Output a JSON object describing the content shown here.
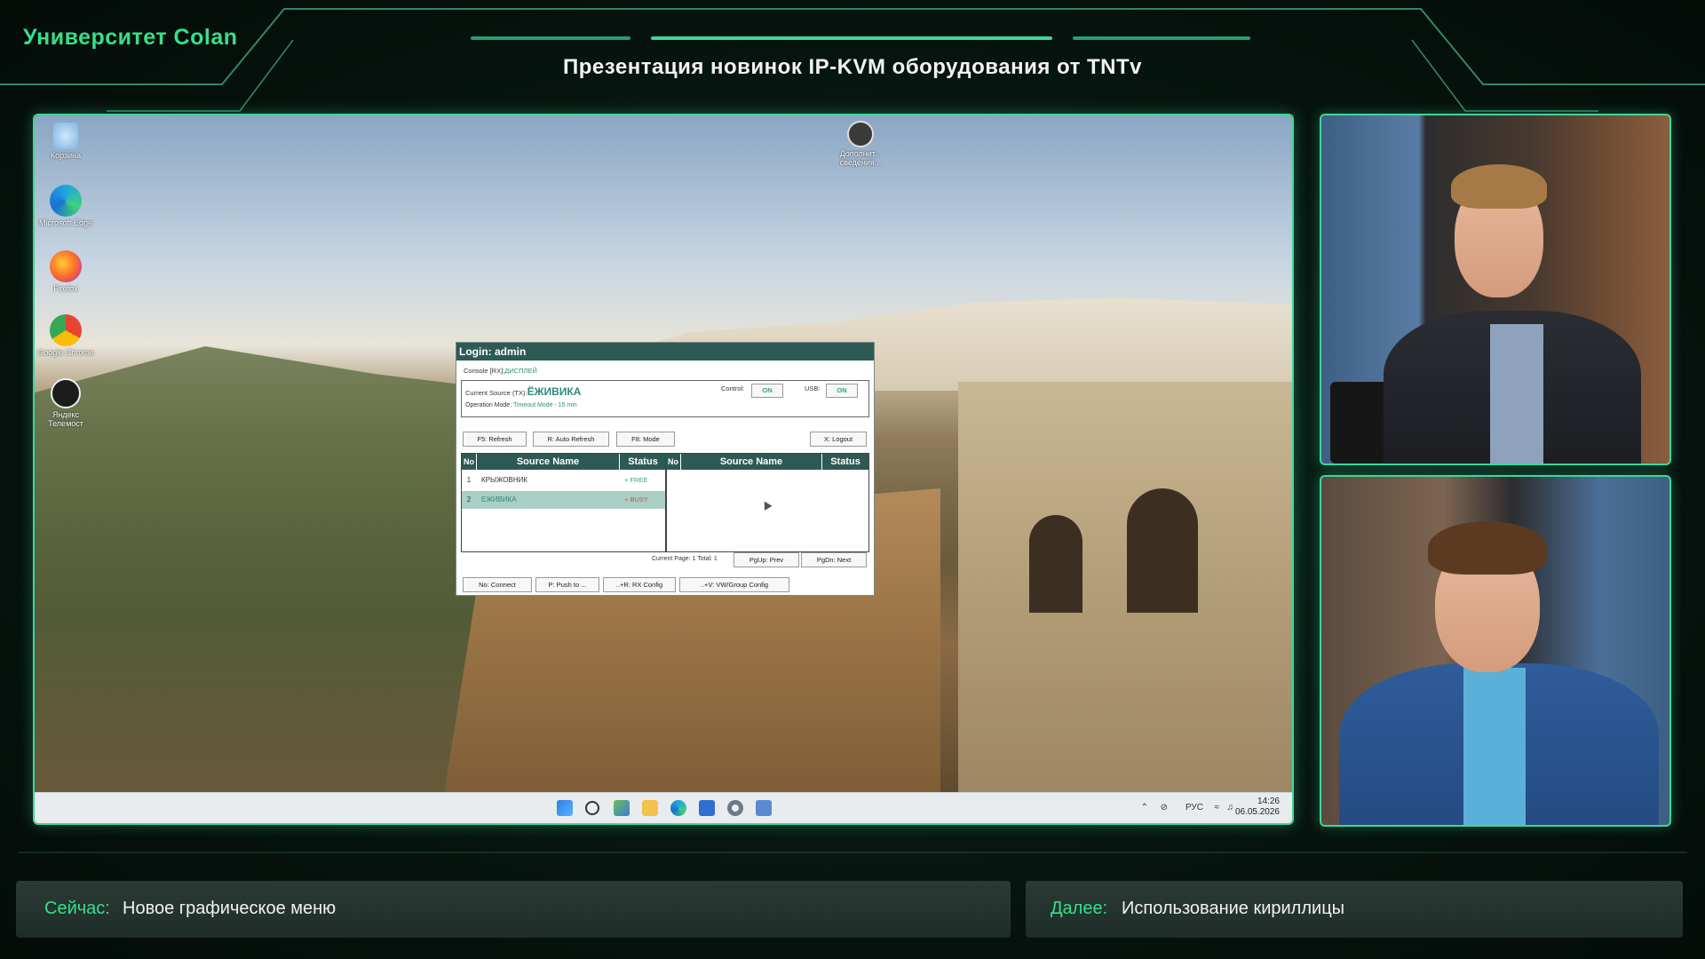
{
  "header": {
    "brand": "Университет Colan",
    "title": "Презентация новинок IP-KVM оборудования от TNTv"
  },
  "desktop": {
    "icons": [
      {
        "label": "Корзина",
        "icon": "recycle-bin-icon"
      },
      {
        "label": "Microsoft Edge",
        "icon": "edge-icon"
      },
      {
        "label": "Firefox",
        "icon": "firefox-icon"
      },
      {
        "label": "Google Chrome",
        "icon": "chrome-icon"
      },
      {
        "label": "Яндекс Телемост",
        "icon": "telemost-icon"
      }
    ],
    "top_icon": {
      "label": "Дополнит... сведения...",
      "icon": "user-circle-icon"
    }
  },
  "kvm": {
    "window_title": "Login: admin",
    "console_label": "Console [RX]:",
    "console_value": "ДИСПЛЕЙ",
    "current_source_label": "Current Source (TX):",
    "current_source_value": "ЁЖИВИКА",
    "operation_mode_label": "Operation Mode:",
    "operation_mode_value": "Timeout Mode - 15 min",
    "control_label": "Control:",
    "control_value": "ON",
    "usb_label": "USB:",
    "usb_value": "ON",
    "buttons_top": [
      "F5: Refresh",
      "R: Auto Refresh",
      "F8: Mode",
      "X: Logout"
    ],
    "columns": [
      "No",
      "Source Name",
      "Status"
    ],
    "rows_left": [
      {
        "no": "1",
        "name": "КРЫЖОВНИК",
        "status": "+ FREE"
      },
      {
        "no": "2",
        "name": "ЕЖИВИКА",
        "status": "+ BUSY"
      }
    ],
    "current_page_label": "Current Page: 1 Total: 1",
    "page_buttons": [
      "PgUp: Prev",
      "PgDn: Next"
    ],
    "buttons_bottom": [
      "No: Connect",
      "P: Push to ...",
      "..+R: RX Config",
      "..+V: VW/Group Config"
    ]
  },
  "tray": {
    "lang": "РУС",
    "time": "14:26",
    "date": "06.05.2026"
  },
  "lower_third": {
    "now_key": "Сейчас:",
    "now_value": "Новое графическое меню",
    "next_key": "Далее:",
    "next_value": "Использование кириллицы"
  },
  "colors": {
    "accent": "#35e08a",
    "kvm_header": "#2d5a54",
    "free": "#2fa67a",
    "busy": "#e04a3a"
  }
}
